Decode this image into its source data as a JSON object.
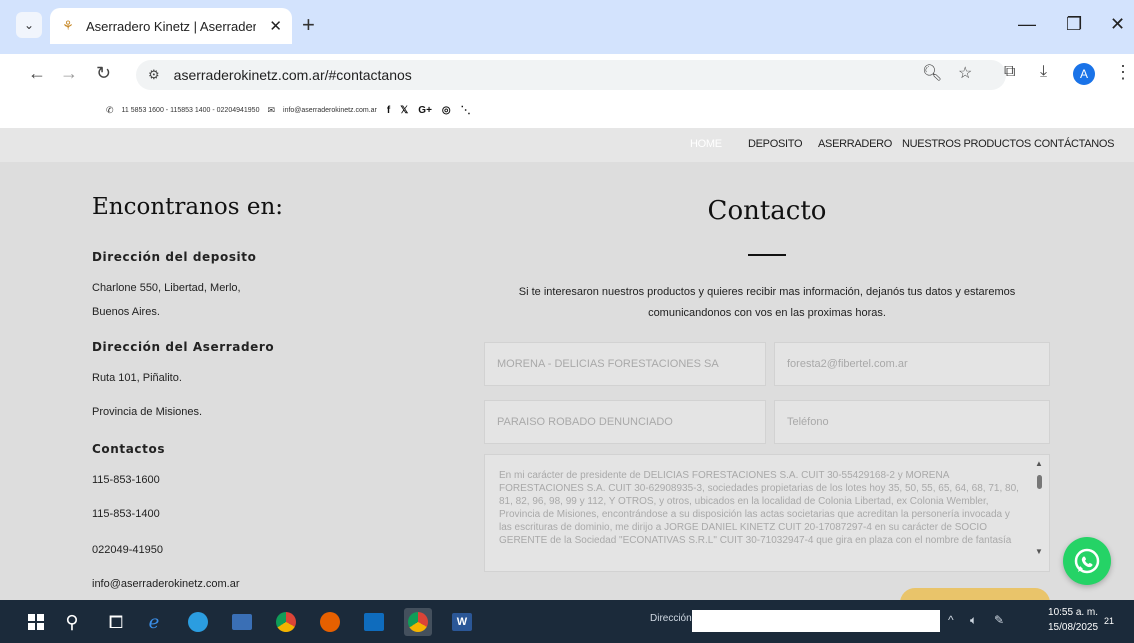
{
  "browser": {
    "tab_title": "Aserradero Kinetz | Aserradero",
    "url": "aserraderokinetz.com.ar/#contactanos",
    "profile_initial": "A"
  },
  "site_topbar": {
    "phones": "11 5853 1600 - 115853 1400 - 02204941950",
    "email": "info@aserraderokinetz.com.ar",
    "social": [
      "f",
      "𝕏",
      "G+",
      "◎",
      "⋱"
    ]
  },
  "site_nav": {
    "items": [
      "HOME",
      "DEPOSITO",
      "ASERRADERO",
      "NUESTROS PRODUCTOS",
      "CONTÁCTANOS"
    ]
  },
  "left": {
    "heading": "Encontranos en:",
    "deposito_title": "Dirección del deposito",
    "deposito_line1": "Charlone 550, Libertad, Merlo,",
    "deposito_line2": "Buenos Aires.",
    "aserradero_title": "Dirección del Aserradero",
    "aserradero_line1": "Ruta 101, Piñalito.",
    "aserradero_line2": "Provincia de Misiones.",
    "contactos_title": "Contactos",
    "phone1": "115-853-1600",
    "phone2": "115-853-1400",
    "phone3": "022049-41950",
    "email": "info@aserraderokinetz.com.ar"
  },
  "form": {
    "heading": "Contacto",
    "lead": "Si te interesaron nuestros productos y quieres recibir mas información, dejanós tus datos y estaremos comunicandonos con vos en las proximas horas.",
    "name_value": "MORENA - DELICIAS FORESTACIONES SA",
    "email_value": "foresta2@fibertel.com.ar",
    "subject_value": "PARAISO ROBADO DENUNCIADO",
    "phone_placeholder": "Teléfono",
    "message_value": "En mi carácter de presidente de DELICIAS FORESTACIONES S.A. CUIT 30-55429168-2 y MORENA FORESTACIONES S.A. CUIT 30-62908935-3, sociedades propietarias de los lotes hoy 35, 50, 55, 65, 64, 68, 71, 80, 81, 82, 96, 98, 99 y 112, Y OTROS, y otros, ubicados en la localidad de Colonia Libertad, ex Colonia Wembler, Provincia de Misiones, encontrándose a su disposición las actas societarias que acreditan la personería invocada y las escrituras de dominio, me dirijo a JORGE DANIEL KINETZ CUIT 20-17087297-4 en su carácter de SOCIO GERENTE de la Sociedad \"ECONATIVAS S.R.L\" CUIT 30-71032947-4 que gira en plaza con el nombre de fantasía"
  },
  "taskbar": {
    "address_label": "Dirección",
    "time": "10:55 a. m.",
    "date": "15/08/2025",
    "notif_count": "21"
  },
  "colors": {
    "whatsapp": "#25d366",
    "send_button": "#e9c46a",
    "chrome_tabbar": "#d3e3fd"
  }
}
